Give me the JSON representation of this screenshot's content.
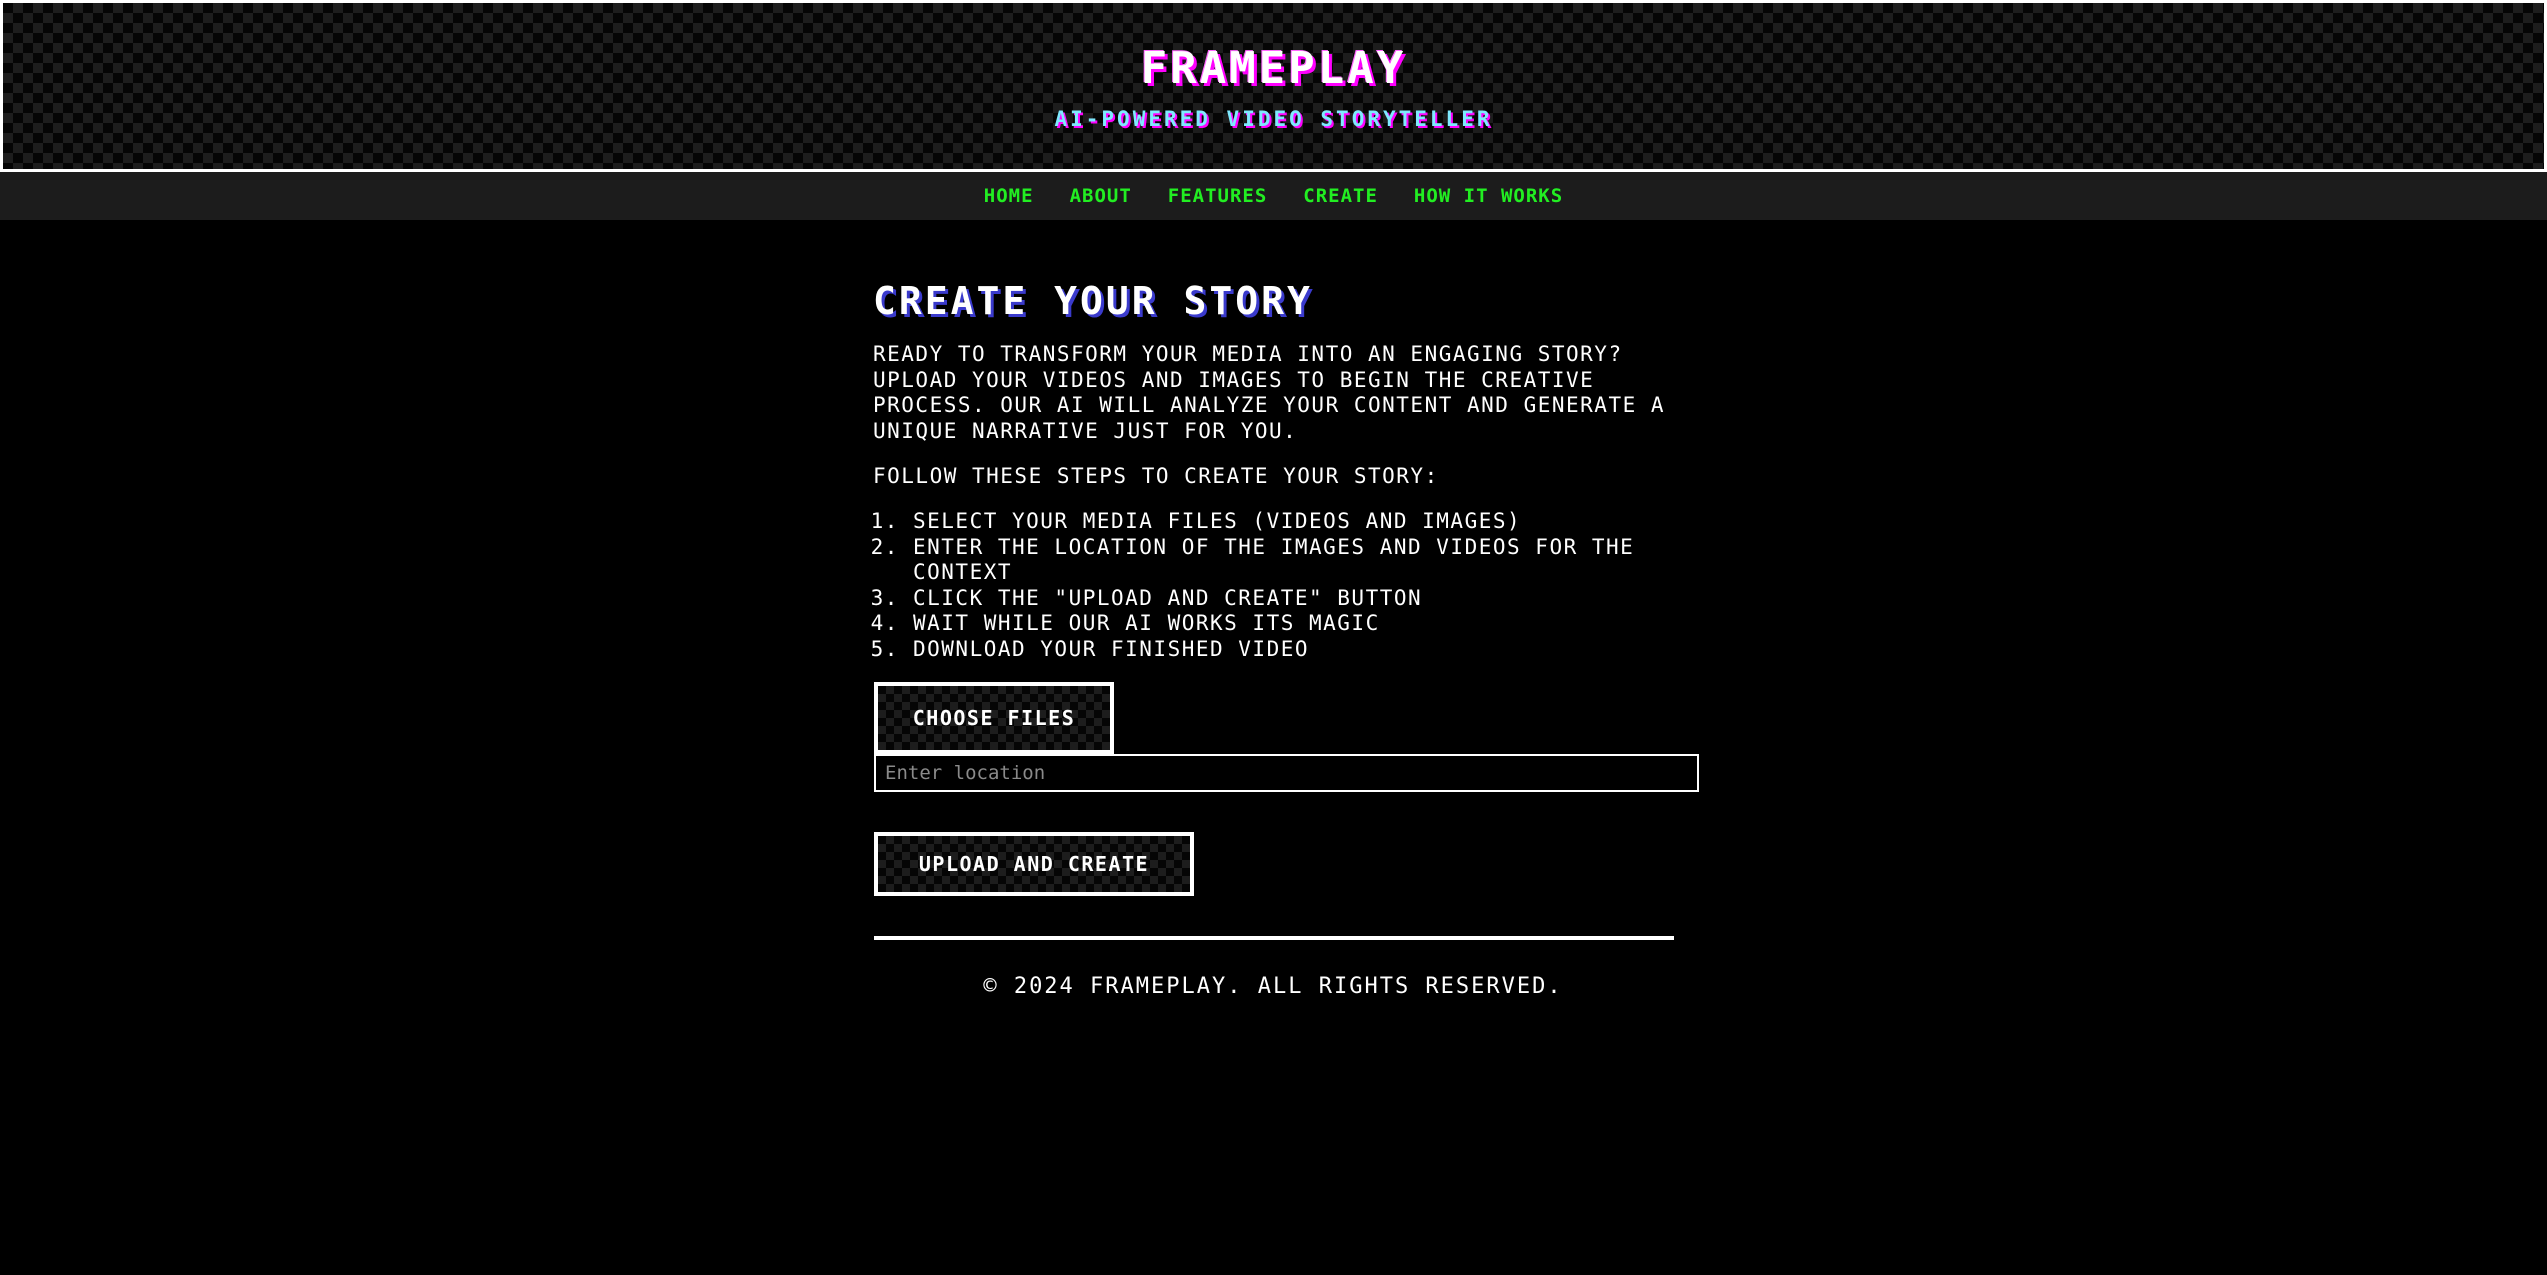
{
  "header": {
    "title": "FRAMEPLAY",
    "subtitle": "AI-POWERED VIDEO STORYTELLER"
  },
  "nav": {
    "items": [
      {
        "label": "HOME"
      },
      {
        "label": "ABOUT"
      },
      {
        "label": "FEATURES"
      },
      {
        "label": "CREATE"
      },
      {
        "label": "HOW IT WORKS"
      }
    ]
  },
  "main": {
    "title": "CREATE YOUR STORY",
    "intro": "READY TO TRANSFORM YOUR MEDIA INTO AN ENGAGING STORY? UPLOAD YOUR VIDEOS AND IMAGES TO BEGIN THE CREATIVE PROCESS. OUR AI WILL ANALYZE YOUR CONTENT AND GENERATE A UNIQUE NARRATIVE JUST FOR YOU.",
    "steps_lead": "FOLLOW THESE STEPS TO CREATE YOUR STORY:",
    "steps": [
      "SELECT YOUR MEDIA FILES (VIDEOS AND IMAGES)",
      "ENTER THE LOCATION OF THE IMAGES AND VIDEOS FOR THE CONTEXT",
      "CLICK THE \"UPLOAD AND CREATE\" BUTTON",
      "WAIT WHILE OUR AI WORKS ITS MAGIC",
      "DOWNLOAD YOUR FINISHED VIDEO"
    ]
  },
  "form": {
    "choose_files_label": "CHOOSE FILES",
    "location_value": "",
    "location_placeholder": "Enter location",
    "upload_label": "UPLOAD AND CREATE"
  },
  "footer": {
    "copyright": "© 2024 FRAMEPLAY. ALL RIGHTS RESERVED."
  },
  "colors": {
    "background": "#000000",
    "nav_background": "#1c1c1c",
    "nav_link": "#22ee22",
    "title_shadow": "#ff00ff",
    "subtitle": "#7fe9ff",
    "heading_shadow": "#3a3acc"
  }
}
